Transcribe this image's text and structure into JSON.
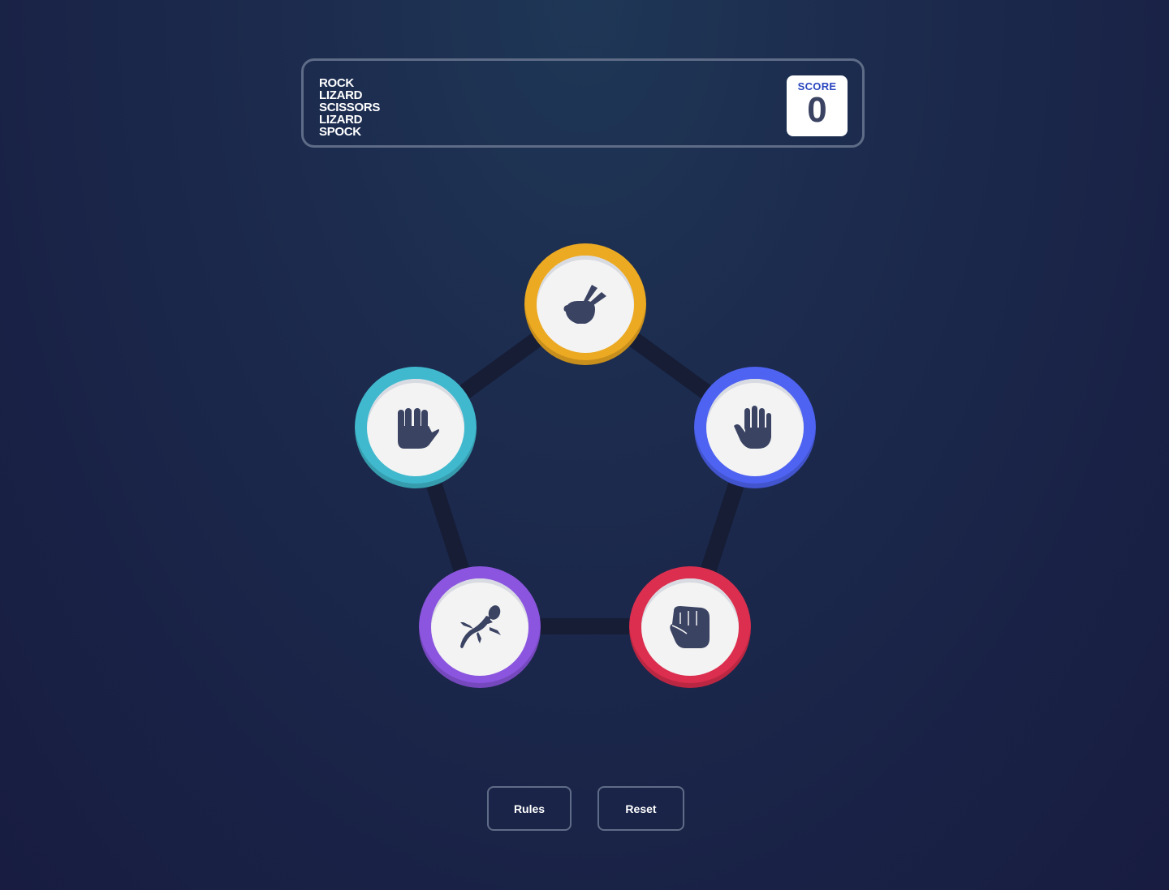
{
  "header": {
    "title_lines": [
      "ROCK",
      "LIZARD",
      "SCISSORS",
      "LIZARD",
      "SPOCK"
    ],
    "score_label": "SCORE",
    "score_value": "0"
  },
  "choices": [
    {
      "id": "scissors",
      "icon": "scissors-hand-icon",
      "color": "#eca922"
    },
    {
      "id": "paper",
      "icon": "paper-hand-icon",
      "color": "#4e63f2"
    },
    {
      "id": "rock",
      "icon": "rock-fist-icon",
      "color": "#dc2e4e"
    },
    {
      "id": "lizard",
      "icon": "lizard-icon",
      "color": "#8b55e0"
    },
    {
      "id": "spock",
      "icon": "spock-hand-icon",
      "color": "#40b9ce"
    }
  ],
  "buttons": {
    "rules_label": "Rules",
    "reset_label": "Reset"
  },
  "colors": {
    "background": "#1c2b4e",
    "border": "#5f6c87",
    "score_label": "#2a46c0",
    "score_value": "#3b4363",
    "icon": "#3b4363",
    "pentagon_line": "#161d35"
  }
}
